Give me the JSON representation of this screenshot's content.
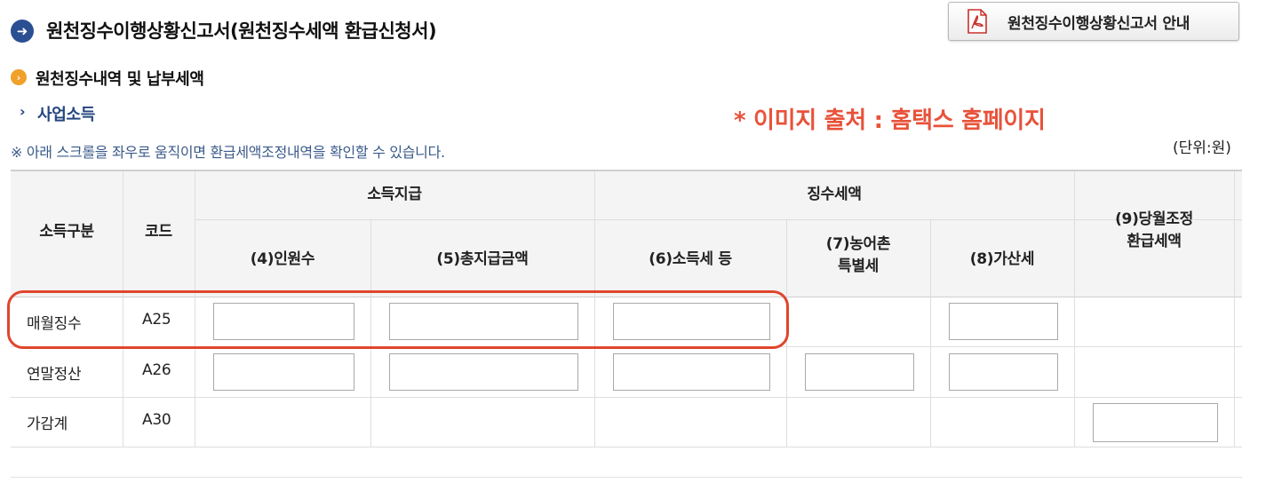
{
  "header": {
    "title": "원천징수이행상황신고서(원천징수세액 환급신청서)",
    "guide_button_label": "원천징수이행상황신고서 안내"
  },
  "section": {
    "title": "원천징수내역 및 납부세액",
    "subsection": "사업소득"
  },
  "source_note": "* 이미지 출처 : 홈택스 홈페이지",
  "scroll_note": "※ 아래 스크롤을 좌우로 움직이면 환급세액조정내역을 확인할 수 있습니다.",
  "unit_note": "(단위:원)",
  "table": {
    "headers": {
      "income_type": "소득구분",
      "code": "코드",
      "group_payment": "소득지급",
      "group_tax": "징수세액",
      "headcount": "(4)인원수",
      "total_payment": "(5)총지급금액",
      "income_tax": "(6)소득세 등",
      "rural_tax_line1": "(7)농어촌",
      "rural_tax_line2": "특별세",
      "surcharge": "(8)가산세",
      "refund_line1": "(9)당월조정",
      "refund_line2": "환급세액"
    },
    "rows": [
      {
        "type": "매월징수",
        "code": "A25"
      },
      {
        "type": "연말정산",
        "code": "A26"
      },
      {
        "type": "가감계",
        "code": "A30"
      }
    ]
  },
  "colors": {
    "accent_blue": "#24467f",
    "note_red": "#e8523a",
    "bullet_orange": "#f0a12a"
  },
  "icons": [
    "arrow-right-circle-icon",
    "pdf-file-icon",
    "orange-bullet-icon",
    "chevron-right-icon"
  ]
}
